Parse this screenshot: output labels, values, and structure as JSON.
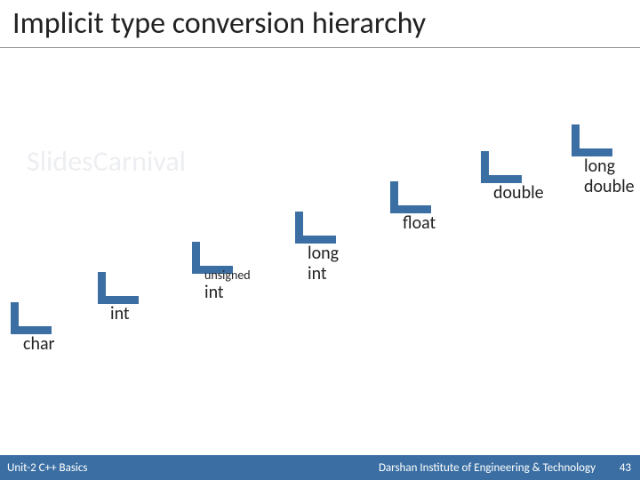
{
  "title": "Implicit type conversion hierarchy",
  "watermark": "SlidesCarnival",
  "steps": {
    "char": {
      "label": "char"
    },
    "int": {
      "label": "int"
    },
    "uint": {
      "small": "unsigned",
      "big": "int"
    },
    "lint": {
      "label": "long int"
    },
    "float": {
      "label": "float"
    },
    "double": {
      "label": "double"
    },
    "ldouble": {
      "line1": "long",
      "line2": "double"
    }
  },
  "footer": {
    "unit": "Unit-2 C++ Basics",
    "institute": "Darshan Institute of Engineering & Technology",
    "page_number": "43"
  },
  "chart_data": {
    "type": "other",
    "description": "Stair-step diagram showing C++ implicit type conversion hierarchy from lowest to highest rank",
    "hierarchy_low_to_high": [
      "char",
      "int",
      "unsigned int",
      "long int",
      "float",
      "double",
      "long double"
    ]
  }
}
